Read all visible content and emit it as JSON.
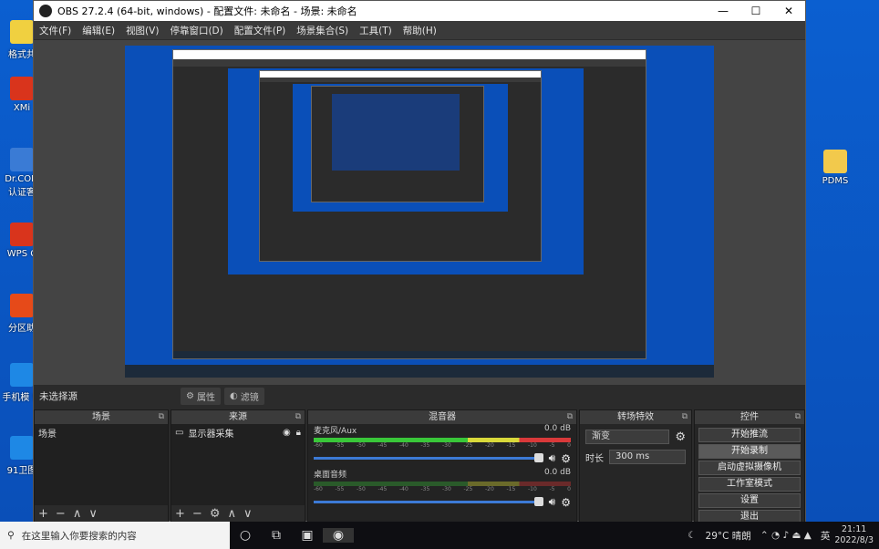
{
  "window": {
    "title": "OBS 27.2.4 (64-bit, windows) - 配置文件: 未命名 - 场景: 未命名",
    "min": "—",
    "max": "☐",
    "close": "✕"
  },
  "menu": [
    "文件(F)",
    "编辑(E)",
    "视图(V)",
    "停靠窗口(D)",
    "配置文件(P)",
    "场景集合(S)",
    "工具(T)",
    "帮助(H)"
  ],
  "desktop_icons": [
    {
      "label": "格式共",
      "color": "#f0d040"
    },
    {
      "label": "XMi",
      "color": "#d9341c"
    },
    {
      "label": "Dr.COM 认证客",
      "color": "#3a7bd5"
    },
    {
      "label": "WPS C",
      "color": "#d9341c"
    },
    {
      "label": "分区助",
      "color": "#e64a19"
    },
    {
      "label": "手机模 师",
      "color": "#1e88e5"
    },
    {
      "label": "91卫图",
      "color": "#1e88e5"
    },
    {
      "label": "PDMS",
      "color": "#f2c94c"
    }
  ],
  "source_bar": {
    "no_source": "未选择源",
    "properties": "属性",
    "filters": "滤镜"
  },
  "docks": {
    "scenes": {
      "title": "场景",
      "items": [
        "场景"
      ]
    },
    "sources": {
      "title": "来源",
      "items": [
        "显示器采集"
      ]
    },
    "mixer": {
      "title": "混音器",
      "channels": [
        {
          "name": "麦克风/Aux",
          "db": "0.0 dB"
        },
        {
          "name": "桌面音频",
          "db": "0.0 dB"
        }
      ],
      "scale": [
        "-60",
        "-55",
        "-50",
        "-45",
        "-40",
        "-35",
        "-30",
        "-25",
        "-20",
        "-15",
        "-10",
        "-5",
        "0"
      ]
    },
    "transitions": {
      "title": "转场特效",
      "type": "渐变",
      "duration_label": "时长",
      "duration": "300 ms"
    },
    "controls": {
      "title": "控件",
      "buttons": [
        "开始推流",
        "开始录制",
        "启动虚拟摄像机",
        "工作室模式",
        "设置",
        "退出"
      ]
    }
  },
  "taskbar": {
    "search_placeholder": "在这里输入你要搜索的内容",
    "weather": "29°C 晴朗",
    "ime": "英",
    "time": "21:11",
    "date": "2022/8/3"
  }
}
